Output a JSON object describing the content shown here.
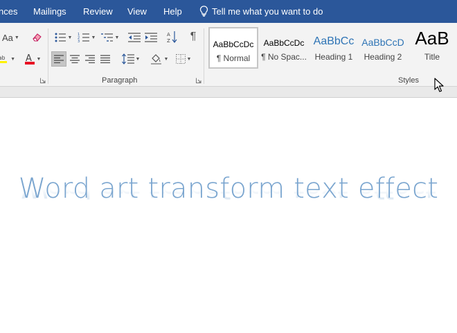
{
  "tabs": [
    {
      "label": "nces"
    },
    {
      "label": "Mailings"
    },
    {
      "label": "Review"
    },
    {
      "label": "View"
    },
    {
      "label": "Help"
    }
  ],
  "tell_me": {
    "text": "Tell me what you want to do"
  },
  "ribbon": {
    "font_case_label": "Aa",
    "groups": {
      "paragraph": "Paragraph",
      "styles": "Styles"
    },
    "style_gallery": [
      {
        "preview": "AaBbCcDc",
        "name": "¶ Normal"
      },
      {
        "preview": "AaBbCcDc",
        "name": "¶ No Spac..."
      },
      {
        "preview": "AaBbCc",
        "name": "Heading 1"
      },
      {
        "preview": "AaBbCcD",
        "name": "Heading 2"
      },
      {
        "preview": "AaB",
        "name": "Title"
      }
    ]
  },
  "document": {
    "wordart_text": "Word art transform text effect"
  },
  "colors": {
    "tabbar": "#2b579a",
    "wordart": "#7aa5cf",
    "heading": "#2e74b5",
    "font_color_red": "#e81123",
    "highlight_yellow": "#fff200"
  }
}
